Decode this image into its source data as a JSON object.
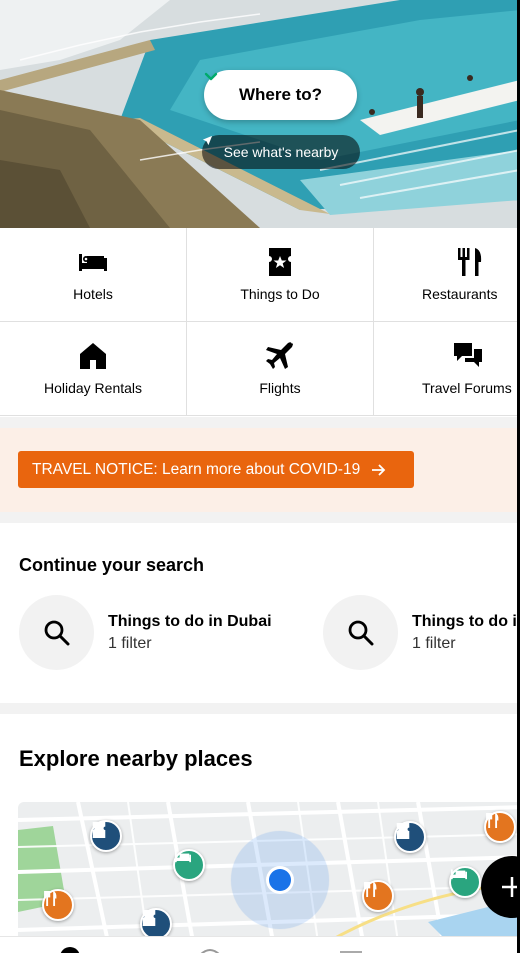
{
  "hero": {
    "search_label": "Where to?",
    "nearby_label": "See what's nearby"
  },
  "categories": [
    {
      "label": "Hotels",
      "icon": "bed-icon"
    },
    {
      "label": "Things to Do",
      "icon": "ticket-icon"
    },
    {
      "label": "Restaurants",
      "icon": "fork-knife-icon"
    },
    {
      "label": "Holiday Rentals",
      "icon": "house-icon"
    },
    {
      "label": "Flights",
      "icon": "plane-icon"
    },
    {
      "label": "Travel Forums",
      "icon": "chat-bubbles-icon"
    }
  ],
  "notice": {
    "label": "TRAVEL NOTICE: Learn more about COVID-19",
    "color": "#e9650e"
  },
  "continue_search": {
    "title": "Continue your search",
    "items": [
      {
        "title": "Things to do in Dubai",
        "subtitle": "1 filter"
      },
      {
        "title": "Things to do in",
        "subtitle": "1 filter"
      }
    ]
  },
  "explore": {
    "title": "Explore nearby places"
  },
  "colors": {
    "accent": "#e9650e",
    "pin_attraction": "#1f4f7a",
    "pin_hotel": "#2aa57f",
    "pin_restaurant": "#e3751f",
    "location_dot": "#1a73e8"
  }
}
